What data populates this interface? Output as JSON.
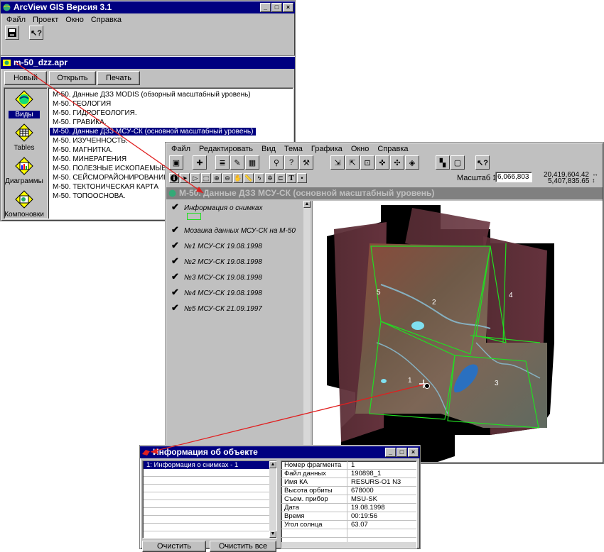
{
  "app": {
    "title": "ArcView GIS Версия 3.1",
    "menu": [
      "Файл",
      "Проект",
      "Окно",
      "Справка"
    ]
  },
  "project": {
    "title": "m-50_dzz.apr",
    "buttons": {
      "new": "Новый",
      "open": "Открыть",
      "print": "Печать"
    },
    "doc_types": [
      "Виды",
      "Tables",
      "Диаграммы",
      "Компоновки"
    ],
    "views": [
      "M-50. Данные ДЗЗ MODIS (обзорный масштабный уровень)",
      "M-50. ГЕОЛОГИЯ",
      "M-50. ГИДРОГЕОЛОГИЯ.",
      "M-50. ГРАВИКА.",
      "M-50. Данные ДЗЗ МСУ-СК (основной масштабный уровень)",
      "M-50. ИЗУЧЕННОСТЬ.",
      "M-50. МАГНИТКА.",
      "M-50. МИНЕРАГЕНИЯ",
      "M-50. ПОЛЕЗНЫЕ ИСКОПАЕМЫЕ.",
      "M-50. СЕЙСМОРАЙОНИРОВАНИЕ.",
      "M-50. ТЕКТОНИЧЕСКАЯ КАРТА",
      "M-50. ТОПООСНОВА."
    ],
    "selected_index": 4
  },
  "view": {
    "menu": [
      "Файл",
      "Редактировать",
      "Вид",
      "Тема",
      "Графика",
      "Окно",
      "Справка"
    ],
    "scale_label": "Масштаб 1:",
    "scale_value": "6,066,803",
    "coord_x": "20,419,604.42",
    "coord_y": "5,407,835.65",
    "title": "M-50. Данные ДЗЗ МСУ-СК (основной масштабный уровень)",
    "themes": [
      "Информация о снимках",
      "Мозаика данных МСУ-СК на M-50",
      "№1 МСУ-СК 19.08.1998",
      "№2 МСУ-СК 19.08.1998",
      "№3 МСУ-СК 19.08.1998",
      "№4 МСУ-СК 19.08.1998",
      "№5 МСУ-СК 21.09.1997"
    ],
    "map_labels": [
      "1",
      "2",
      "3",
      "4",
      "5"
    ],
    "colors": {
      "footprint": "#22dd22",
      "imagery": "#7a5048"
    }
  },
  "identify": {
    "title": "Информация об объекте",
    "results": [
      "1: Информация о снимках - 1"
    ],
    "properties": [
      {
        "k": "Номер фрагмента",
        "v": "1"
      },
      {
        "k": "Файл данных",
        "v": "190898_1"
      },
      {
        "k": "Имя КА",
        "v": "RESURS-O1 N3"
      },
      {
        "k": "Высота орбиты",
        "v": "678000"
      },
      {
        "k": "Съем. прибор",
        "v": "MSU-SK"
      },
      {
        "k": "Дата",
        "v": "19.08.1998"
      },
      {
        "k": "Время",
        "v": "00:19:56"
      },
      {
        "k": "Угол солнца",
        "v": "63.07"
      }
    ],
    "buttons": {
      "clear": "Очистить",
      "clear_all": "Очистить все"
    }
  }
}
